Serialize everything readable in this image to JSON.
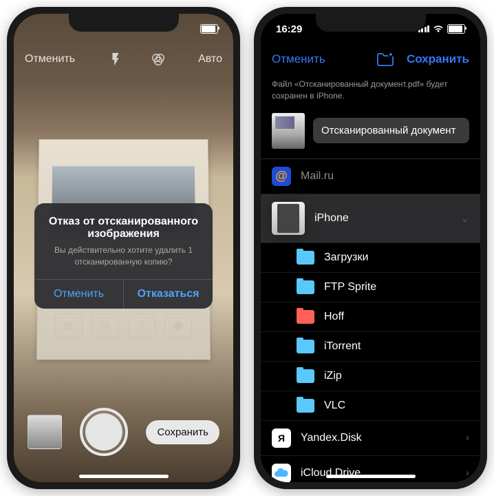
{
  "status": {
    "time": "16:29"
  },
  "p1": {
    "nav": {
      "cancel": "Отменить",
      "auto": "Авто"
    },
    "alert": {
      "title": "Отказ от отсканированного изображения",
      "msg": "Вы действительно хотите удалить 1 отсканированную копию?",
      "cancel": "Отменить",
      "discard": "Отказаться"
    },
    "save": "Сохранить"
  },
  "p2": {
    "nav": {
      "cancel": "Отменить",
      "save": "Сохранить"
    },
    "info": "Файл «Отсканированный документ.pdf» будет сохранен в iPhone.",
    "docname": "Отсканированный документ",
    "locs": {
      "mail": "Mail.ru",
      "iphone": "iPhone",
      "downloads": "Загрузки",
      "ftp": "FTP Sprite",
      "hoff": "Hoff",
      "itorrent": "iTorrent",
      "izip": "iZip",
      "vlc": "VLC",
      "yandex": "Yandex.Disk",
      "icloud": "iCloud Drive"
    }
  }
}
